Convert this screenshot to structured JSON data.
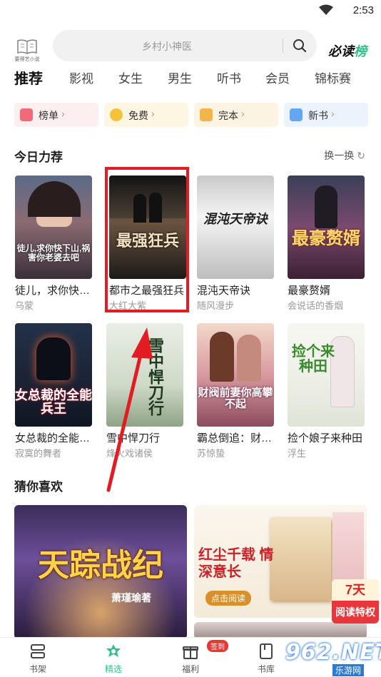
{
  "status_bar": {
    "time": "2:53"
  },
  "header": {
    "logo_label": "要得艺小说",
    "search_placeholder": "乡村小神医",
    "must_read_a": "必读",
    "must_read_b": "榜"
  },
  "tabs": [
    "推荐",
    "影视",
    "女生",
    "男生",
    "听书",
    "会员",
    "锦标赛"
  ],
  "chips": [
    {
      "label": "榜单",
      "icon": "gift-icon",
      "color": "#f06a7a"
    },
    {
      "label": "免费",
      "icon": "coin-icon",
      "color": "#f5c33b"
    },
    {
      "label": "完本",
      "icon": "shield-check-icon",
      "color": "#f1b54a"
    },
    {
      "label": "新书",
      "icon": "new-badge-icon",
      "color": "#63a7f2"
    }
  ],
  "today_section": {
    "title": "今日力荐",
    "refresh": "换一换"
  },
  "books": [
    {
      "title": "徒儿，求你快…",
      "author": "乌蒙",
      "cover_text": "徒儿,求你快下山,祸害你老婆去吧"
    },
    {
      "title": "都市之最强狂兵",
      "author": "大红大紫",
      "cover_text": "最强狂兵"
    },
    {
      "title": "混沌天帝诀",
      "author": "随风漫步",
      "cover_text": "混沌天帝诀"
    },
    {
      "title": "最豪赘婿",
      "author": "会说话的香烟",
      "cover_text": "最豪赘婿"
    },
    {
      "title": "女总裁的全能…",
      "author": "寂寞的舞者",
      "cover_text": "女总裁的全能兵王"
    },
    {
      "title": "雪中悍刀行",
      "author": "烽火戏诸侯",
      "cover_text": "雪中悍刀行"
    },
    {
      "title": "霸总倒追：财…",
      "author": "苏惊蛰",
      "cover_text": "财阀前妻你高攀不起"
    },
    {
      "title": "捡个娘子来种田",
      "author": "浮生",
      "cover_text": "捡个来种田"
    }
  ],
  "guess_section": {
    "title": "猜你喜欢"
  },
  "guess_covers": [
    {
      "title": "天踪战纪",
      "author": "萧瑾瑜著"
    },
    {
      "title": "红尘千载 情深意长",
      "tag": "点击阅读"
    }
  ],
  "promo_badge": {
    "top": "7天",
    "bottom": "阅读特权"
  },
  "bottom_nav": [
    {
      "label": "书架",
      "icon": "bookshelf-icon"
    },
    {
      "label": "精选",
      "icon": "flower-icon"
    },
    {
      "label": "福利",
      "icon": "gift-box-icon"
    },
    {
      "label": "书库",
      "icon": "book-icon"
    }
  ],
  "sign_badge": "签到",
  "watermark": {
    "big": "962.NET",
    "small": "乐游网"
  }
}
